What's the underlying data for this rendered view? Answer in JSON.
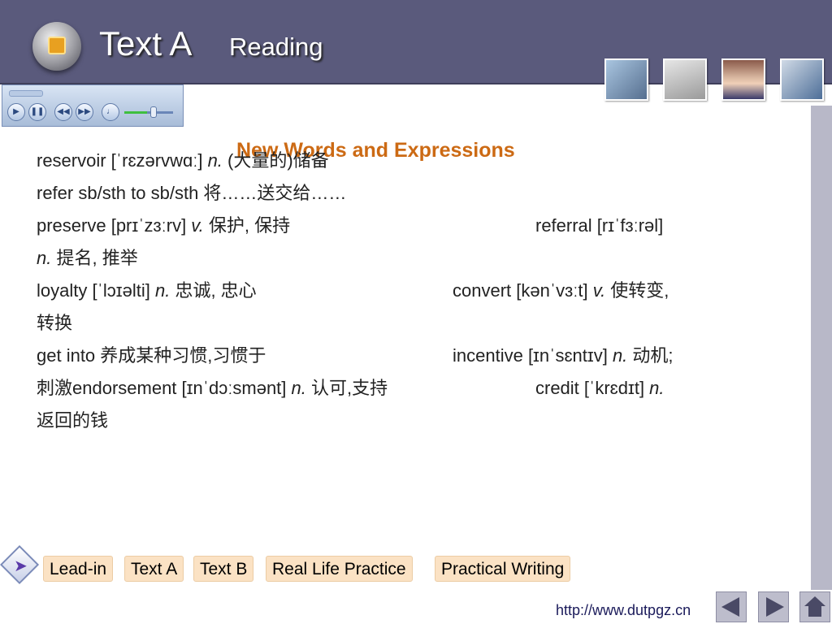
{
  "header": {
    "title": "Text A",
    "subtitle": "Reading"
  },
  "section": {
    "title": "New Words and Expressions"
  },
  "vocab_lines": [
    {
      "pre": "reservoir [ˈrɛzərvwɑː] ",
      "pos": "n.",
      "post": " (大量的)储备"
    },
    {
      "pre": "refer sb/sth to sb/sth 将……送交给……",
      "pos": "",
      "post": ""
    },
    {
      "pre": "preserve [prɪˈzɜːrv] ",
      "pos": "v.",
      "post": " 保护, 保持"
    },
    {
      "pre": "referral [rɪˈfɜːrəl]",
      "pos": "",
      "post": ""
    },
    {
      "pre": "",
      "pos": "n.",
      "post": " 提名, 推举"
    },
    {
      "pre": "loyalty [ˈlɔɪəlti] ",
      "pos": "n.",
      "post": " 忠诚, 忠心"
    },
    {
      "pre": "convert [kənˈvɜːt] ",
      "pos": "v.",
      "post": " 使转变,"
    },
    {
      "pre": "转换",
      "pos": "",
      "post": ""
    },
    {
      "pre": "get into 养成某种习惯,习惯于",
      "pos": "",
      "post": ""
    },
    {
      "pre": "incentive [ɪnˈsɛntɪv] ",
      "pos": "n.",
      "post": " 动机;"
    },
    {
      "pre": "刺激endorsement [ɪnˈdɔːsmənt] ",
      "pos": "n.",
      "post": " 认可,支持"
    },
    {
      "pre": "credit [ˈkrɛdɪt] ",
      "pos": "n.",
      "post": ""
    },
    {
      "pre": "返回的钱",
      "pos": "",
      "post": ""
    }
  ],
  "nav": {
    "buttons": [
      "Lead-in",
      "Text A",
      "Text B",
      "Real Life Practice",
      "Practical Writing"
    ]
  },
  "footer": {
    "url": "http://www.dutpgz.cn"
  },
  "icons": {
    "logo": "square-logo-icon",
    "nav_back": "diamond-arrow-icon",
    "prev": "triangle-left-icon",
    "next": "triangle-right-icon",
    "home": "home-icon"
  },
  "colors": {
    "header_bg": "#5a5a7c",
    "section_title": "#cc6a14",
    "nav_button_bg": "#fbe2c4",
    "side_bar": "#b8b8c8"
  }
}
